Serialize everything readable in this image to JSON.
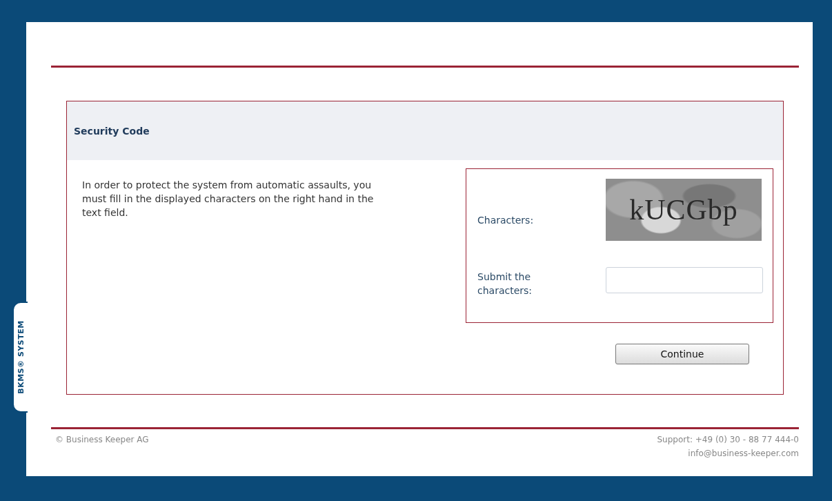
{
  "side_tab": {
    "label": "BKMS® SYSTEM"
  },
  "panel": {
    "title": "Security Code",
    "instructions": "In order to protect the system from automatic assaults, you must fill in the displayed characters on the right hand in the text field.",
    "captcha": {
      "label": "Characters:",
      "text": "kUCGbp"
    },
    "answer": {
      "label": "Submit the characters:"
    },
    "button": "Continue"
  },
  "footer": {
    "copyright": "© Business Keeper AG",
    "support": "Support: +49 (0) 30 - 88 77 444-0",
    "email": "info@business-keeper.com"
  }
}
